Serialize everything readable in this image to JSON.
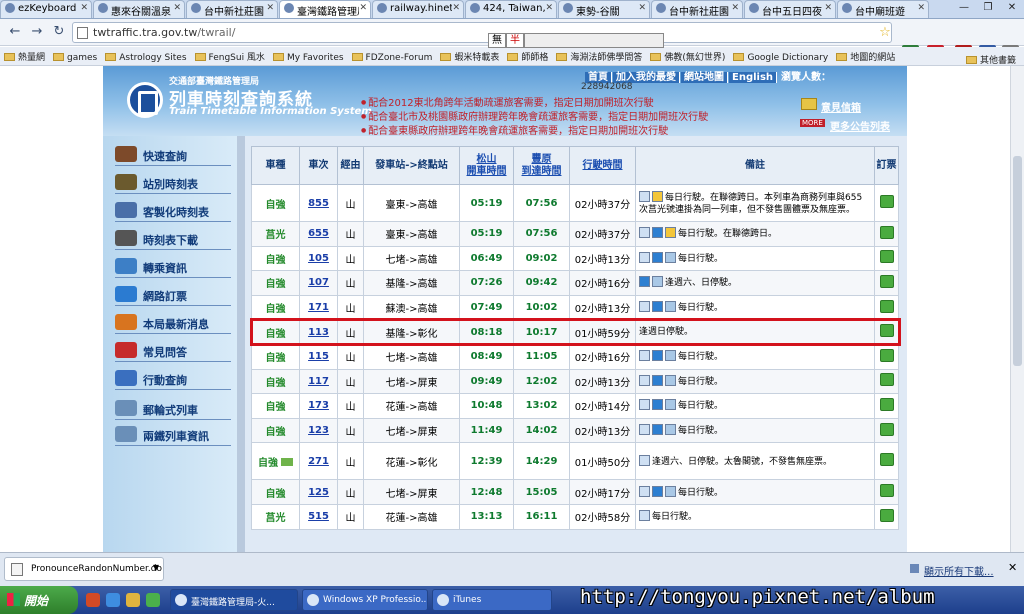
{
  "browser": {
    "tabs": [
      {
        "label": "ezKeyboard",
        "active": false
      },
      {
        "label": "惠來谷關溫泉",
        "active": false
      },
      {
        "label": "台中新社莊園",
        "active": false
      },
      {
        "label": "臺灣鐵路管理局",
        "active": true
      },
      {
        "label": "railway.hinet",
        "active": false
      },
      {
        "label": "424, Taiwan,",
        "active": false
      },
      {
        "label": "東勢-谷關",
        "active": false
      },
      {
        "label": "台中新社莊園",
        "active": false
      },
      {
        "label": "台中五日四夜",
        "active": false
      },
      {
        "label": "台中廟班遊",
        "active": false
      }
    ],
    "url_host": "twtraffic.tra.gov.tw",
    "url_path": "/twrail/",
    "ime_chars": [
      "無",
      "半"
    ],
    "bookmarks": [
      "熱量網",
      "games",
      "Astrology Sites",
      "FengSui 風水",
      "My Favorites",
      "FDZone-Forum",
      "蝦米特載表",
      "師師格",
      "海淵法師佛學問答",
      "佛教(無幻世界)",
      "Google Dictionary",
      "地圖的網站"
    ],
    "bookmarks_other": "其他書籤",
    "colors": {
      "accent": "#1c4f9c",
      "highlight": "#d3121c"
    }
  },
  "site": {
    "org": "交通部臺灣鐵路管理局",
    "title": "列車時刻查詢系統",
    "title_en": "Train Timetable Information System",
    "top_links": [
      "首頁",
      "加入我的最愛",
      "網站地圖",
      "English"
    ],
    "visits_label": "瀏覽人數：",
    "visits_count": "228942068",
    "notices": [
      "配合2012東北角跨年活動疏運旅客需要，指定日期加開班次行駛",
      "配合臺北市及桃園縣政府辦理跨年晚會疏運旅客需要，指定日期加開班次行駛",
      "配合臺東縣政府辦理跨年晚會疏運旅客需要，指定日期加開班次行駛"
    ],
    "notice_link": "意見信箱",
    "more_badge": "MORE",
    "more_link": "更多公告列表"
  },
  "sidebar": {
    "items": [
      {
        "label": "快速查詢",
        "icon": "train-icon"
      },
      {
        "label": "站別時刻表",
        "icon": "timetable-icon"
      },
      {
        "label": "客製化時刻表",
        "icon": "laptop-icon"
      },
      {
        "label": "時刻表下載",
        "icon": "printer-icon"
      },
      {
        "label": "轉乘資訊",
        "icon": "globe-icon"
      },
      {
        "label": "網路訂票",
        "icon": "globe-ticket-icon"
      },
      {
        "label": "本局最新消息",
        "icon": "news-icon"
      },
      {
        "label": "常見問答",
        "icon": "question-icon"
      },
      {
        "label": "行動查詢",
        "icon": "mobile-icon"
      },
      {
        "label": "郵輪式列車",
        "icon": "cruise-train-icon"
      },
      {
        "label": "兩鐵列車資訊",
        "icon": "bike-train-icon"
      }
    ]
  },
  "timetable": {
    "headers": [
      "車種",
      "車次",
      "經由",
      "發車站->終點站",
      "松山",
      "開車時間",
      "豐原",
      "到達時間",
      "行駛時間",
      "備註",
      "訂票"
    ],
    "rows": [
      {
        "type": "自強",
        "train": "855",
        "via": "山",
        "route": "臺東->高雄",
        "dep": "05:19",
        "arr": "07:56",
        "dur": "02小時37分",
        "icons": [
          "b",
          "y"
        ],
        "note": "每日行駛。在聯德跨日。本列車為商務列車與655次莒光號連掛為同一列車，但不發售團體票及無座票。",
        "tall": true
      },
      {
        "type": "莒光",
        "train": "655",
        "via": "山",
        "route": "臺東->高雄",
        "dep": "05:19",
        "arr": "07:56",
        "dur": "02小時37分",
        "icons": [
          "b",
          "h",
          "y"
        ],
        "note": "每日行駛。在聯德跨日。",
        "tall": false
      },
      {
        "type": "自強",
        "train": "105",
        "via": "山",
        "route": "七堵->高雄",
        "dep": "06:49",
        "arr": "09:02",
        "dur": "02小時13分",
        "icons": [
          "b",
          "h",
          "g"
        ],
        "note": "每日行駛。",
        "tall": false
      },
      {
        "type": "自強",
        "train": "107",
        "via": "山",
        "route": "基隆->高雄",
        "dep": "07:26",
        "arr": "09:42",
        "dur": "02小時16分",
        "icons": [
          "h",
          "g"
        ],
        "note": "逢週六、日停駛。",
        "tall": false
      },
      {
        "type": "自強",
        "train": "171",
        "via": "山",
        "route": "蘇澳->高雄",
        "dep": "07:49",
        "arr": "10:02",
        "dur": "02小時13分",
        "icons": [
          "b",
          "h",
          "g"
        ],
        "note": "每日行駛。",
        "tall": false
      },
      {
        "type": "自強",
        "train": "113",
        "via": "山",
        "route": "基隆->彰化",
        "dep": "08:18",
        "arr": "10:17",
        "dur": "01小時59分",
        "icons": [],
        "note": "逢週日停駛。",
        "tall": false
      },
      {
        "type": "自強",
        "train": "115",
        "via": "山",
        "route": "七堵->高雄",
        "dep": "08:49",
        "arr": "11:05",
        "dur": "02小時16分",
        "icons": [
          "b",
          "h",
          "g"
        ],
        "note": "每日行駛。",
        "tall": false
      },
      {
        "type": "自強",
        "train": "117",
        "via": "山",
        "route": "七堵->屏東",
        "dep": "09:49",
        "arr": "12:02",
        "dur": "02小時13分",
        "icons": [
          "b",
          "h",
          "g"
        ],
        "note": "每日行駛。",
        "tall": false
      },
      {
        "type": "自強",
        "train": "173",
        "via": "山",
        "route": "花蓮->高雄",
        "dep": "10:48",
        "arr": "13:02",
        "dur": "02小時14分",
        "icons": [
          "b",
          "h",
          "g"
        ],
        "note": "每日行駛。",
        "tall": false
      },
      {
        "type": "自強",
        "train": "123",
        "via": "山",
        "route": "七堵->屏東",
        "dep": "11:49",
        "arr": "14:02",
        "dur": "02小時13分",
        "icons": [
          "b",
          "h",
          "g"
        ],
        "note": "每日行駛。",
        "tall": false
      },
      {
        "type": "自強",
        "train": "271",
        "via": "山",
        "route": "花蓮->彰化",
        "dep": "12:39",
        "arr": "14:29",
        "dur": "01小時50分",
        "icons": [
          "b"
        ],
        "note": "逢週六、日停駛。太魯閣號，不發售無座票。",
        "tall": true,
        "taroko": true
      },
      {
        "type": "自強",
        "train": "125",
        "via": "山",
        "route": "七堵->屏東",
        "dep": "12:48",
        "arr": "15:05",
        "dur": "02小時17分",
        "icons": [
          "b",
          "h",
          "g"
        ],
        "note": "每日行駛。",
        "tall": false
      },
      {
        "type": "莒光",
        "train": "515",
        "via": "山",
        "route": "花蓮->高雄",
        "dep": "13:13",
        "arr": "16:11",
        "dur": "02小時58分",
        "icons": [
          "b"
        ],
        "note": "每日行駛。",
        "tall": false
      }
    ]
  },
  "downloads": {
    "file": "PronounceRandonNumber.do",
    "show_all": "顯示所有下載..."
  },
  "taskbar": {
    "start": "開始",
    "tasks": [
      "臺灣鐵路管理局-火...",
      "Windows XP Professio...",
      "iTunes"
    ],
    "watermark": "http://tongyou.pixnet.net/album"
  }
}
